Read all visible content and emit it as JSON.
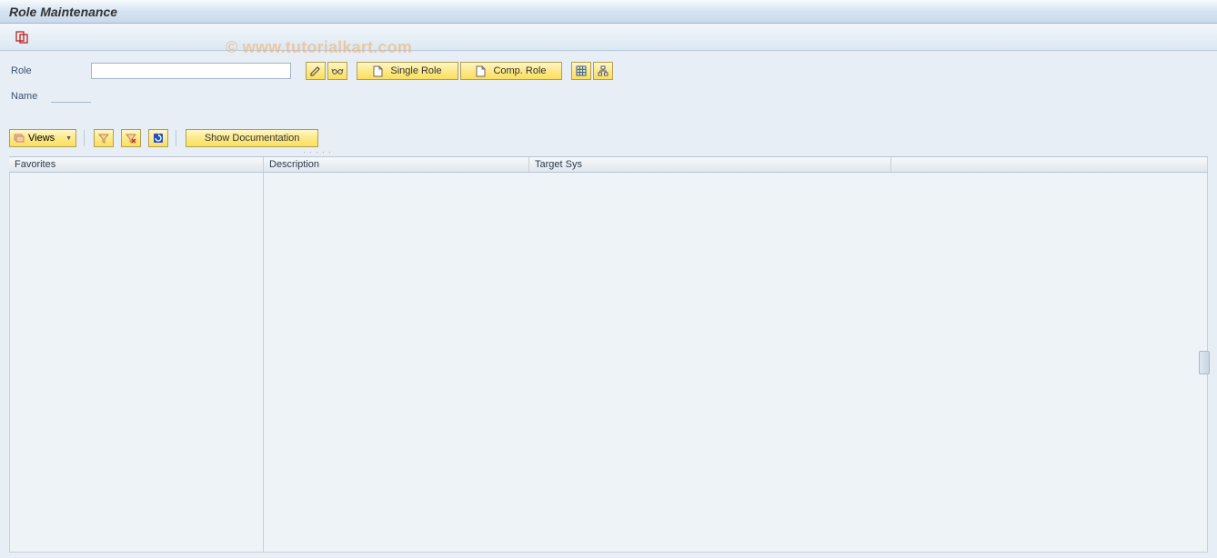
{
  "window": {
    "title": "Role Maintenance"
  },
  "watermark": "© www.tutorialkart.com",
  "form": {
    "role_label": "Role",
    "role_value": "",
    "name_label": "Name",
    "name_value": ""
  },
  "toolbar": {
    "single_role": "Single Role",
    "comp_role": "Comp. Role"
  },
  "second_toolbar": {
    "views_label": "Views",
    "show_doc": "Show Documentation"
  },
  "grid": {
    "columns": {
      "favorites": "Favorites",
      "description": "Description",
      "target_sys": "Target Sys"
    },
    "rows": []
  }
}
